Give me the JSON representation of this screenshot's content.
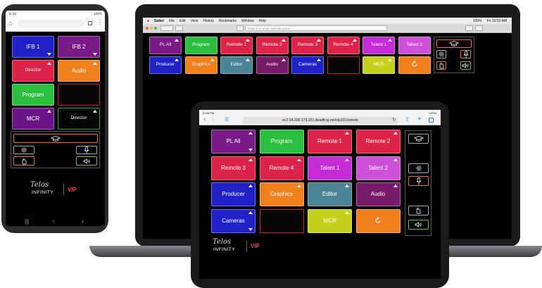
{
  "colors": {
    "blue": "#2121c9",
    "purple": "#7a1a87",
    "red": "#dd2348",
    "orange": "#f07f1e",
    "green": "#2cbf3f",
    "magenta": "#c52bd6",
    "orchid": "#cf4fd8",
    "teal": "#4b8595",
    "yellow": "#c5d11c",
    "wine": "#7a1b6a"
  },
  "laptop": {
    "menubar": {
      "apple": "",
      "items": [
        "Safari",
        "File",
        "Edit",
        "View",
        "History",
        "Bookmarks",
        "Window",
        "Help"
      ],
      "right": [
        "100%",
        "Fri 10:53 AM"
      ]
    },
    "address_placeholder": "Search or enter website name",
    "keys": [
      {
        "label": "PL All",
        "color": "purple",
        "up": true
      },
      {
        "label": "Program",
        "color": "green",
        "up": false
      },
      {
        "label": "Remote 1",
        "color": "red",
        "up": true
      },
      {
        "label": "Remote 2",
        "color": "red",
        "up": true
      },
      {
        "label": "Remote 3",
        "color": "red",
        "up": true
      },
      {
        "label": "Remote 4",
        "color": "red",
        "up": true
      },
      {
        "label": "Talent 1",
        "color": "magenta",
        "up": true
      },
      {
        "label": "Talent 2",
        "color": "orchid",
        "up": false
      },
      {
        "label": "Producer",
        "color": "blue",
        "up": true
      },
      {
        "label": "Graphics",
        "color": "orange",
        "up": true
      },
      {
        "label": "Editor",
        "color": "teal",
        "up": true
      },
      {
        "label": "Audio",
        "color": "wine",
        "up": true
      },
      {
        "label": "Cameras",
        "color": "blue",
        "up": true
      },
      {
        "label": "",
        "color": "empty",
        "up": false
      },
      {
        "label": "MCR",
        "color": "yellow",
        "up": true
      },
      {
        "label": "",
        "color": "orange",
        "up": false
      }
    ]
  },
  "tablet": {
    "time": "12:38 PM",
    "battery": "100%",
    "url": "ec2-34-236-173-201.deadfrog.net/vip101/remote",
    "keys": [
      {
        "label": "PL All",
        "color": "purple",
        "up": true,
        "down": true
      },
      {
        "label": "Program",
        "color": "green",
        "up": false,
        "down": false
      },
      {
        "label": "Remote 1",
        "color": "red",
        "up": true,
        "down": false
      },
      {
        "label": "Remote 2",
        "color": "red",
        "up": true,
        "down": false
      },
      {
        "label": "Remote 3",
        "color": "red",
        "up": true,
        "down": false
      },
      {
        "label": "Remote 4",
        "color": "red",
        "up": true,
        "down": false
      },
      {
        "label": "Talent 1",
        "color": "magenta",
        "up": true,
        "down": false
      },
      {
        "label": "Talent 2",
        "color": "orchid",
        "up": true,
        "down": false
      },
      {
        "label": "Producer",
        "color": "blue",
        "up": true,
        "down": false
      },
      {
        "label": "Graphics",
        "color": "orange",
        "up": true,
        "down": false
      },
      {
        "label": "Editor",
        "color": "teal",
        "up": true,
        "down": false
      },
      {
        "label": "Audio",
        "color": "wine",
        "up": true,
        "down": false
      },
      {
        "label": "Cameras",
        "color": "blue",
        "up": true,
        "down": true
      },
      {
        "label": "",
        "color": "empty",
        "up": false,
        "down": false
      },
      {
        "label": "MCR",
        "color": "yellow",
        "up": true,
        "down": false
      },
      {
        "label": "",
        "color": "orange",
        "up": false,
        "down": false
      }
    ],
    "logo": {
      "brand": "Telos",
      "product": "INFINITY",
      "badge": "VIP"
    }
  },
  "phone": {
    "time": "11:44",
    "battery": "100%",
    "keys": [
      {
        "label": "IFB 1",
        "color": "blue",
        "up": false,
        "down": true
      },
      {
        "label": "IFB 2",
        "color": "purple",
        "up": false,
        "down": true
      },
      {
        "label": "Director",
        "color": "red",
        "up": true,
        "down": false
      },
      {
        "label": "Audio",
        "color": "orange",
        "up": true,
        "down": false
      },
      {
        "label": "Program",
        "color": "green",
        "up": false,
        "down": false
      },
      {
        "label": "",
        "color": "empty",
        "up": false,
        "down": false
      },
      {
        "label": "MCR",
        "color": "purple",
        "up": true,
        "down": false
      },
      {
        "label": "Director",
        "color": "empty",
        "up": true,
        "down": false
      }
    ],
    "logo": {
      "brand": "Telos",
      "product": "INFINITY",
      "badge": "VIP"
    }
  },
  "icons": {
    "hat": "hat-icon",
    "gear": "gear-icon",
    "mic": "microphone-icon",
    "hand": "hand-icon",
    "speaker": "speaker-icon",
    "refresh": "refresh-icon"
  }
}
